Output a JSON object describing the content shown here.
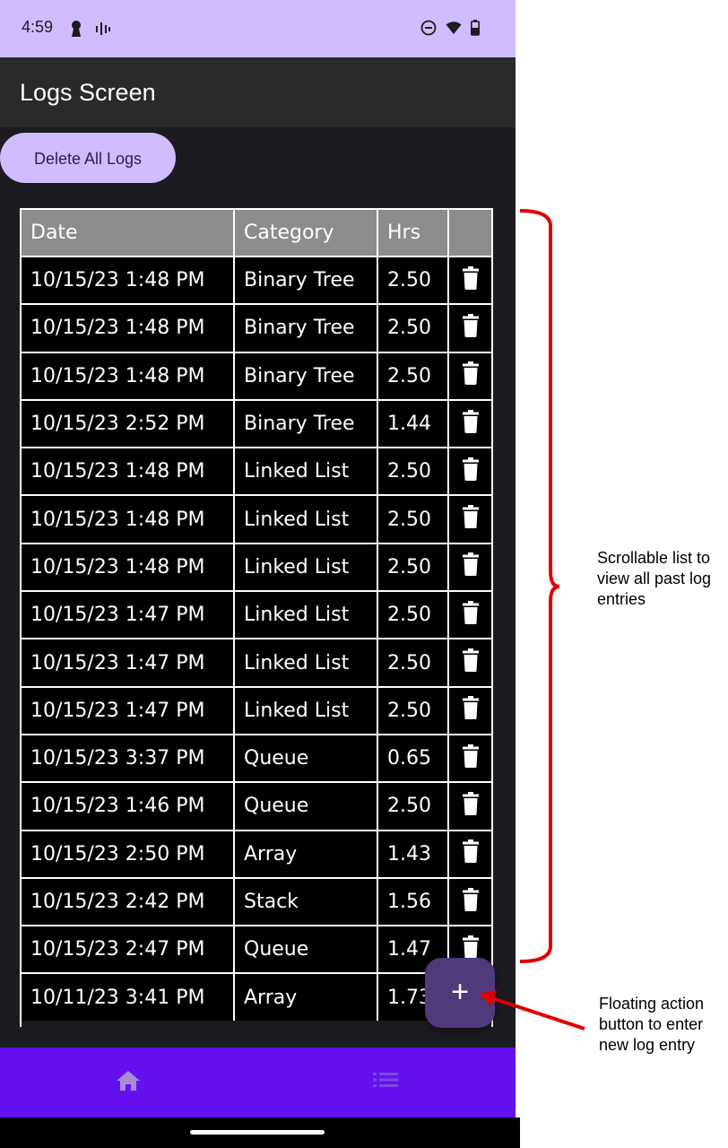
{
  "status_bar": {
    "time": "4:59"
  },
  "app_bar": {
    "title": "Logs Screen"
  },
  "actions": {
    "delete_all_label": "Delete All Logs"
  },
  "table": {
    "headers": {
      "date": "Date",
      "category": "Category",
      "hrs": "Hrs"
    },
    "rows": [
      {
        "date": "10/15/23 1:48 PM",
        "category": "Binary Tree",
        "hrs": "2.50"
      },
      {
        "date": "10/15/23 1:48 PM",
        "category": "Binary Tree",
        "hrs": "2.50"
      },
      {
        "date": "10/15/23 1:48 PM",
        "category": "Binary Tree",
        "hrs": "2.50"
      },
      {
        "date": "10/15/23 2:52 PM",
        "category": "Binary Tree",
        "hrs": "1.44"
      },
      {
        "date": "10/15/23 1:48 PM",
        "category": "Linked List",
        "hrs": "2.50"
      },
      {
        "date": "10/15/23 1:48 PM",
        "category": "Linked List",
        "hrs": "2.50"
      },
      {
        "date": "10/15/23 1:48 PM",
        "category": "Linked List",
        "hrs": "2.50"
      },
      {
        "date": "10/15/23 1:47 PM",
        "category": "Linked List",
        "hrs": "2.50"
      },
      {
        "date": "10/15/23 1:47 PM",
        "category": "Linked List",
        "hrs": "2.50"
      },
      {
        "date": "10/15/23 1:47 PM",
        "category": "Linked List",
        "hrs": "2.50"
      },
      {
        "date": "10/15/23 3:37 PM",
        "category": "Queue",
        "hrs": "0.65"
      },
      {
        "date": "10/15/23 1:46 PM",
        "category": "Queue",
        "hrs": "2.50"
      },
      {
        "date": "10/15/23 2:50 PM",
        "category": "Array",
        "hrs": "1.43"
      },
      {
        "date": "10/15/23 2:42 PM",
        "category": "Stack",
        "hrs": "1.56"
      },
      {
        "date": "10/15/23 2:47 PM",
        "category": "Queue",
        "hrs": "1.47"
      },
      {
        "date": "10/11/23 3:41 PM",
        "category": "Array",
        "hrs": "1.73"
      }
    ]
  },
  "fab": {
    "label": "+"
  },
  "bottom_nav": {
    "items": [
      {
        "icon": "home-icon"
      },
      {
        "icon": "list-icon"
      }
    ]
  },
  "annotations": {
    "list_note": "Scrollable list to view all past log entries",
    "fab_note": "Floating action button to enter new log entry"
  },
  "colors": {
    "status_bar": "#d0bcff",
    "app_bar": "#2a2a2a",
    "background": "#1c1b1f",
    "delete_button": "#d0bcff",
    "fab": "#4f3a7c",
    "bottom_nav": "#6411ed",
    "annotation": "#e00000"
  }
}
